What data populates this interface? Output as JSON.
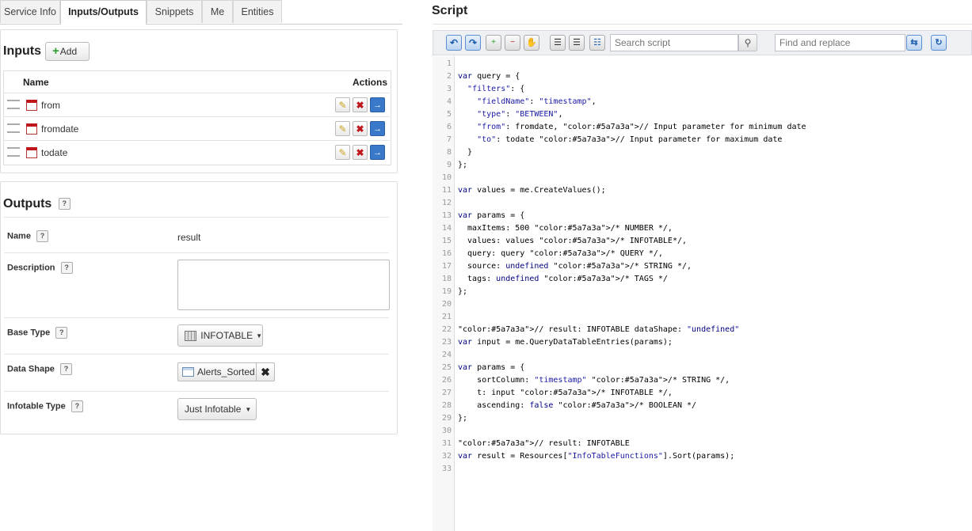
{
  "tabs": [
    "Service Info",
    "Inputs/Outputs",
    "Snippets",
    "Me",
    "Entities"
  ],
  "inputs": {
    "title": "Inputs",
    "add_label": "Add",
    "col_name": "Name",
    "col_actions": "Actions",
    "rows": [
      "from",
      "fromdate",
      "todate"
    ]
  },
  "outputs": {
    "title": "Outputs",
    "help": "?",
    "name_label": "Name",
    "name_value": "result",
    "description_label": "Description",
    "description_value": "",
    "base_type_label": "Base Type",
    "base_type_value": "INFOTABLE",
    "data_shape_label": "Data Shape",
    "data_shape_value": "Alerts_Sorted",
    "infotable_type_label": "Infotable Type",
    "infotable_type_value": "Just Infotable"
  },
  "script": {
    "title": "Script",
    "search_placeholder": "Search script",
    "replace_placeholder": "Find and replace",
    "lines": [
      "",
      "var query = {",
      "  \"filters\": {",
      "    \"fieldName\": \"timestamp\",",
      "    \"type\": \"BETWEEN\",",
      "    \"from\": fromdate, // Input parameter for minimum date",
      "    \"to\": todate // Input parameter for maximum date",
      "  }",
      "};",
      "",
      "var values = me.CreateValues();",
      "",
      "var params = {",
      "  maxItems: 500 /* NUMBER */,",
      "  values: values /* INFOTABLE*/,",
      "  query: query /* QUERY */,",
      "  source: undefined /* STRING */,",
      "  tags: undefined /* TAGS */",
      "};",
      "",
      "",
      "// result: INFOTABLE dataShape: \"undefined\"",
      "var input = me.QueryDataTableEntries(params);",
      "",
      "var params = {",
      "    sortColumn: \"timestamp\" /* STRING */,",
      "    t: input /* INFOTABLE */,",
      "    ascending: false /* BOOLEAN */",
      "};",
      "",
      "// result: INFOTABLE",
      "var result = Resources[\"InfoTableFunctions\"].Sort(params);",
      ""
    ]
  },
  "colors": {
    "keyword": "#000080",
    "string": "#1a1aa6",
    "comment": "#5a7a3a",
    "accent": "#3a78c9",
    "delete": "#c0161b"
  }
}
